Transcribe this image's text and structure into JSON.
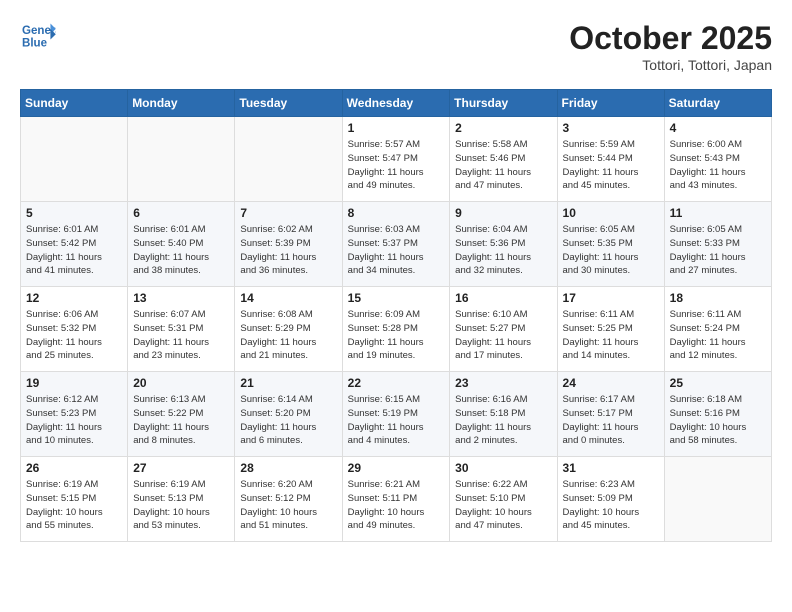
{
  "header": {
    "logo_line1": "General",
    "logo_line2": "Blue",
    "title": "October 2025",
    "subtitle": "Tottori, Tottori, Japan"
  },
  "weekdays": [
    "Sunday",
    "Monday",
    "Tuesday",
    "Wednesday",
    "Thursday",
    "Friday",
    "Saturday"
  ],
  "weeks": [
    [
      {
        "day": "",
        "info": ""
      },
      {
        "day": "",
        "info": ""
      },
      {
        "day": "",
        "info": ""
      },
      {
        "day": "1",
        "info": "Sunrise: 5:57 AM\nSunset: 5:47 PM\nDaylight: 11 hours\nand 49 minutes."
      },
      {
        "day": "2",
        "info": "Sunrise: 5:58 AM\nSunset: 5:46 PM\nDaylight: 11 hours\nand 47 minutes."
      },
      {
        "day": "3",
        "info": "Sunrise: 5:59 AM\nSunset: 5:44 PM\nDaylight: 11 hours\nand 45 minutes."
      },
      {
        "day": "4",
        "info": "Sunrise: 6:00 AM\nSunset: 5:43 PM\nDaylight: 11 hours\nand 43 minutes."
      }
    ],
    [
      {
        "day": "5",
        "info": "Sunrise: 6:01 AM\nSunset: 5:42 PM\nDaylight: 11 hours\nand 41 minutes."
      },
      {
        "day": "6",
        "info": "Sunrise: 6:01 AM\nSunset: 5:40 PM\nDaylight: 11 hours\nand 38 minutes."
      },
      {
        "day": "7",
        "info": "Sunrise: 6:02 AM\nSunset: 5:39 PM\nDaylight: 11 hours\nand 36 minutes."
      },
      {
        "day": "8",
        "info": "Sunrise: 6:03 AM\nSunset: 5:37 PM\nDaylight: 11 hours\nand 34 minutes."
      },
      {
        "day": "9",
        "info": "Sunrise: 6:04 AM\nSunset: 5:36 PM\nDaylight: 11 hours\nand 32 minutes."
      },
      {
        "day": "10",
        "info": "Sunrise: 6:05 AM\nSunset: 5:35 PM\nDaylight: 11 hours\nand 30 minutes."
      },
      {
        "day": "11",
        "info": "Sunrise: 6:05 AM\nSunset: 5:33 PM\nDaylight: 11 hours\nand 27 minutes."
      }
    ],
    [
      {
        "day": "12",
        "info": "Sunrise: 6:06 AM\nSunset: 5:32 PM\nDaylight: 11 hours\nand 25 minutes."
      },
      {
        "day": "13",
        "info": "Sunrise: 6:07 AM\nSunset: 5:31 PM\nDaylight: 11 hours\nand 23 minutes."
      },
      {
        "day": "14",
        "info": "Sunrise: 6:08 AM\nSunset: 5:29 PM\nDaylight: 11 hours\nand 21 minutes."
      },
      {
        "day": "15",
        "info": "Sunrise: 6:09 AM\nSunset: 5:28 PM\nDaylight: 11 hours\nand 19 minutes."
      },
      {
        "day": "16",
        "info": "Sunrise: 6:10 AM\nSunset: 5:27 PM\nDaylight: 11 hours\nand 17 minutes."
      },
      {
        "day": "17",
        "info": "Sunrise: 6:11 AM\nSunset: 5:25 PM\nDaylight: 11 hours\nand 14 minutes."
      },
      {
        "day": "18",
        "info": "Sunrise: 6:11 AM\nSunset: 5:24 PM\nDaylight: 11 hours\nand 12 minutes."
      }
    ],
    [
      {
        "day": "19",
        "info": "Sunrise: 6:12 AM\nSunset: 5:23 PM\nDaylight: 11 hours\nand 10 minutes."
      },
      {
        "day": "20",
        "info": "Sunrise: 6:13 AM\nSunset: 5:22 PM\nDaylight: 11 hours\nand 8 minutes."
      },
      {
        "day": "21",
        "info": "Sunrise: 6:14 AM\nSunset: 5:20 PM\nDaylight: 11 hours\nand 6 minutes."
      },
      {
        "day": "22",
        "info": "Sunrise: 6:15 AM\nSunset: 5:19 PM\nDaylight: 11 hours\nand 4 minutes."
      },
      {
        "day": "23",
        "info": "Sunrise: 6:16 AM\nSunset: 5:18 PM\nDaylight: 11 hours\nand 2 minutes."
      },
      {
        "day": "24",
        "info": "Sunrise: 6:17 AM\nSunset: 5:17 PM\nDaylight: 11 hours\nand 0 minutes."
      },
      {
        "day": "25",
        "info": "Sunrise: 6:18 AM\nSunset: 5:16 PM\nDaylight: 10 hours\nand 58 minutes."
      }
    ],
    [
      {
        "day": "26",
        "info": "Sunrise: 6:19 AM\nSunset: 5:15 PM\nDaylight: 10 hours\nand 55 minutes."
      },
      {
        "day": "27",
        "info": "Sunrise: 6:19 AM\nSunset: 5:13 PM\nDaylight: 10 hours\nand 53 minutes."
      },
      {
        "day": "28",
        "info": "Sunrise: 6:20 AM\nSunset: 5:12 PM\nDaylight: 10 hours\nand 51 minutes."
      },
      {
        "day": "29",
        "info": "Sunrise: 6:21 AM\nSunset: 5:11 PM\nDaylight: 10 hours\nand 49 minutes."
      },
      {
        "day": "30",
        "info": "Sunrise: 6:22 AM\nSunset: 5:10 PM\nDaylight: 10 hours\nand 47 minutes."
      },
      {
        "day": "31",
        "info": "Sunrise: 6:23 AM\nSunset: 5:09 PM\nDaylight: 10 hours\nand 45 minutes."
      },
      {
        "day": "",
        "info": ""
      }
    ]
  ]
}
